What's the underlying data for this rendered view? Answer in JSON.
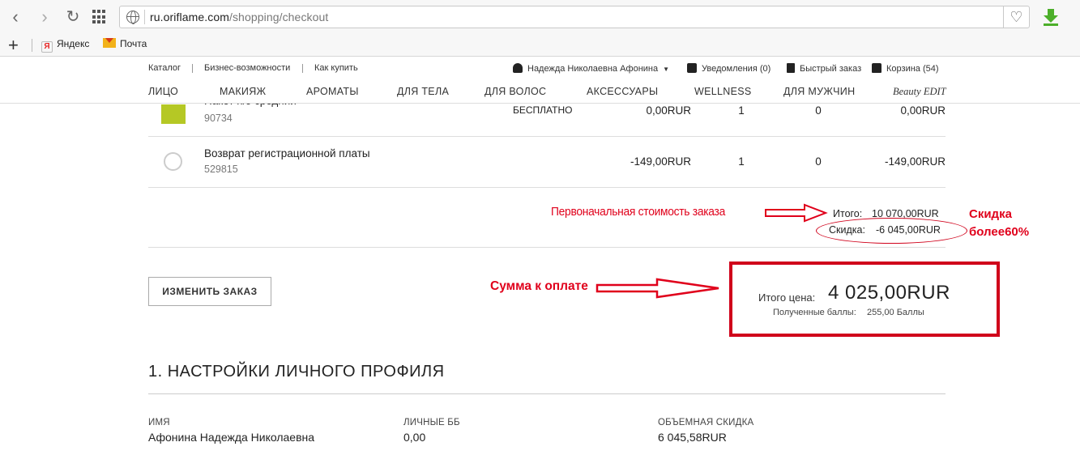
{
  "browser": {
    "url_domain": "ru.oriflame.com",
    "url_path": "/shopping/checkout",
    "bookmarks": [
      {
        "label": "Яндекс"
      },
      {
        "label": "Почта"
      }
    ]
  },
  "header": {
    "utility_links": [
      "Каталог",
      "Бизнес-возможности",
      "Как купить"
    ],
    "user_name": "Надежда Николаевна Афонина",
    "notifications": "Уведомления (0)",
    "quick_order": "Быстрый заказ",
    "cart": "Корзина (54)",
    "categories": [
      "ЛИЦО",
      "МАКИЯЖ",
      "АРОМАТЫ",
      "ДЛЯ ТЕЛА",
      "ДЛЯ ВОЛОС",
      "АКСЕССУАРЫ",
      "WELLNESS",
      "ДЛЯ МУЖЧИН",
      "Beauty EDIT"
    ]
  },
  "cart_rows": [
    {
      "name": "Пакет п/э средний",
      "code": "90734",
      "price_note": "БЕСПЛАТНО",
      "price": "0,00RUR",
      "qty": "1",
      "points": "0",
      "total": "0,00RUR"
    },
    {
      "name": "Возврат регистрационной платы",
      "code": "529815",
      "price_note": "",
      "price": "-149,00RUR",
      "qty": "1",
      "points": "0",
      "total": "-149,00RUR"
    }
  ],
  "totals": {
    "subtotal_label": "Итого:",
    "subtotal_value": "10 070,00RUR",
    "discount_label": "Скидка:",
    "discount_value": "-6 045,00RUR"
  },
  "annotations": {
    "original_cost": "Первоначальная стоимость заказа",
    "discount_note_line1": "Скидка",
    "discount_note_line2": "более60%",
    "amount_to_pay": "Сумма к оплате"
  },
  "change_order_button": "ИЗМЕНИТЬ ЗАКАЗ",
  "payment": {
    "total_label": "Итого цена:",
    "total_value": "4 025,00RUR",
    "points_label": "Полученные баллы:",
    "points_value": "255,00 Баллы"
  },
  "profile": {
    "title": "1. НАСТРОЙКИ ЛИЧНОГО ПРОФИЛЯ",
    "fields": [
      {
        "label": "ИМЯ",
        "value": "Афонина Надежда Николаевна"
      },
      {
        "label": "ЛИЧНЫЕ ББ",
        "value": "0,00"
      },
      {
        "label": "ОБЪЕМНАЯ СКИДКА",
        "value": "6 045,58RUR"
      }
    ]
  },
  "colors": {
    "annotation_red": "#e0001b",
    "product_thumb_green": "#b5c825"
  }
}
